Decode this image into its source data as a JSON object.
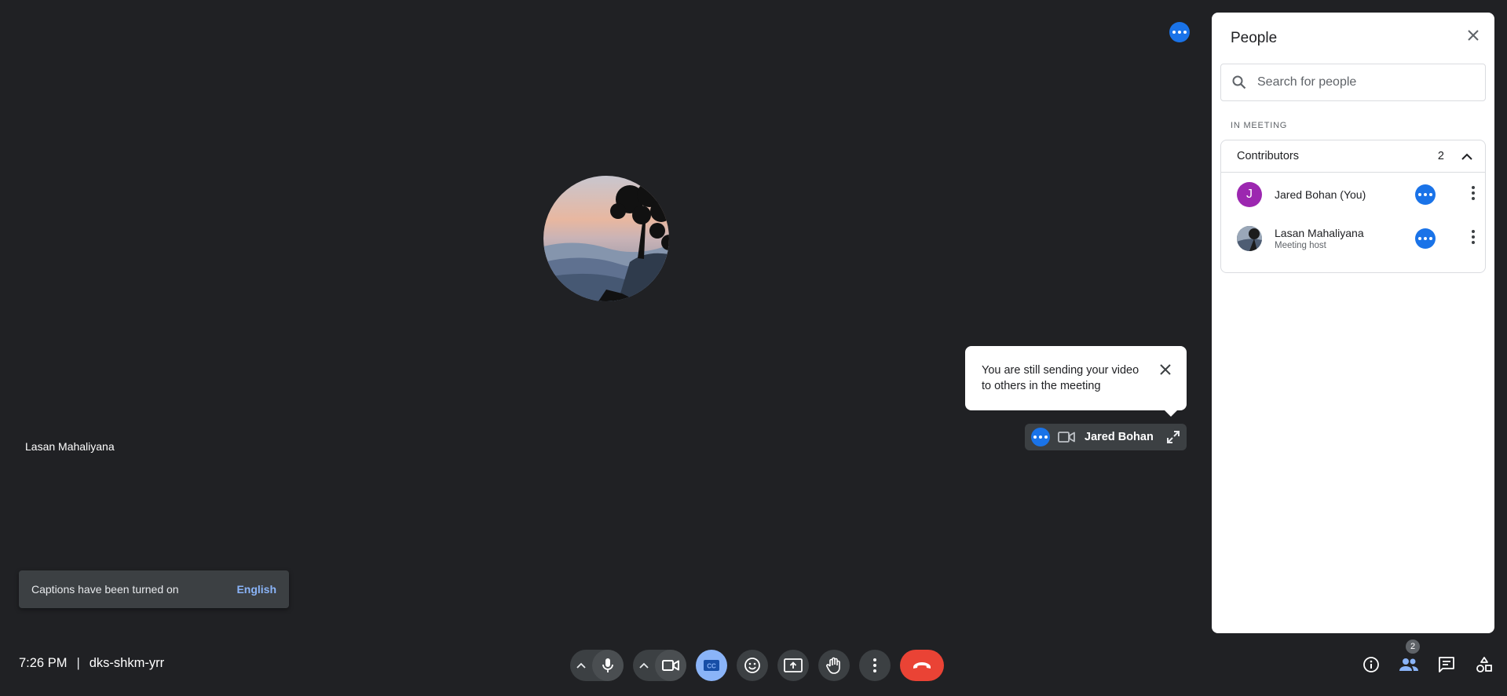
{
  "stage": {
    "remote_name": "Lasan Mahaliyana",
    "tooltip_text": "You are still sending your video to others in the meeting",
    "self_name": "Jared Bohan"
  },
  "captions": {
    "message": "Captions have been turned on",
    "language": "English"
  },
  "meeting": {
    "time": "7:26 PM",
    "separator": "|",
    "code": "dks-shkm-yrr"
  },
  "controls": {
    "participant_count": "2"
  },
  "panel": {
    "title": "People",
    "search_placeholder": "Search for people",
    "section_label": "IN MEETING",
    "group_label": "Contributors",
    "group_count": "2",
    "people": [
      {
        "initial": "J",
        "name": "Jared Bohan (You)",
        "role": "",
        "avatar_color": "#9c27b0"
      },
      {
        "initial": "",
        "name": "Lasan Mahaliyana",
        "role": "Meeting host",
        "avatar_color": "#37474f"
      }
    ]
  },
  "colors": {
    "background": "#202124",
    "accent": "#1a73e8",
    "captions_active": "#8ab4f8",
    "hangup": "#ea4335"
  }
}
